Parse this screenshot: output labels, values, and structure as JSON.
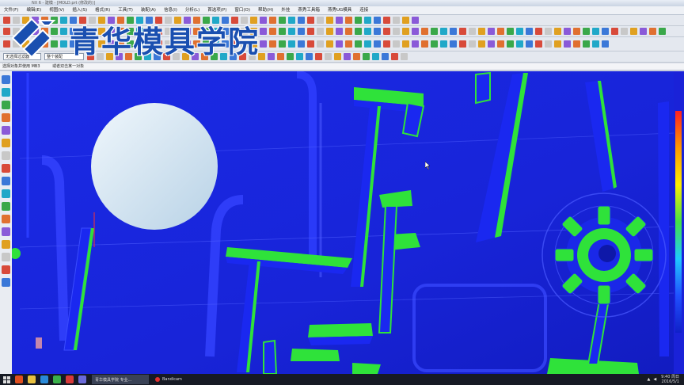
{
  "window": {
    "title": "NX 6 - 建模 - [MOLD.prt (修改的)]"
  },
  "menu": {
    "items": [
      "文件(F)",
      "编辑(E)",
      "视图(V)",
      "插入(S)",
      "格式(R)",
      "工具(T)",
      "装配(A)",
      "信息(I)",
      "分析(L)",
      "首选项(P)",
      "窗口(O)",
      "帮助(H)",
      "外挂",
      "燕秀工具箱",
      "燕秀UG模具",
      "连接"
    ]
  },
  "toolbar": {
    "filter_combo": "无选择过滤器",
    "layer_combo": "整个装配"
  },
  "cue_line": {
    "left": "选择对象并使用 MB3",
    "right": "或者双击某一对象"
  },
  "watermark": {
    "text": "青华模具学院"
  },
  "taskbar": {
    "task1_label": "青华模具学院 专业...",
    "task2_label": "Bandicam",
    "time": "9:40 周日",
    "date": "2016/5/1"
  },
  "colors": {
    "part_blue": "#1020e8",
    "rib_green": "#2fe23a",
    "disk": "#cfe2f0",
    "watermark_blue": "#1a4fb0"
  }
}
